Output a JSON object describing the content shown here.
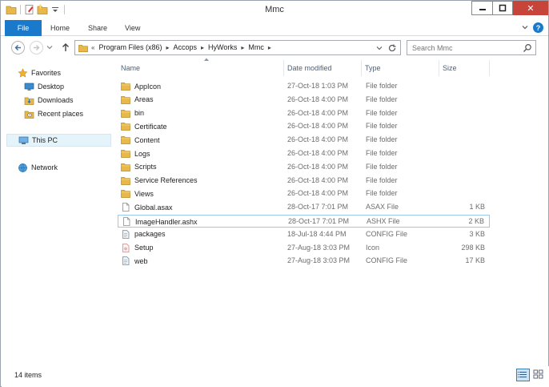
{
  "window": {
    "title": "Mmc",
    "close_glyph": "✕"
  },
  "ribbon": {
    "tabs": [
      {
        "label": "File"
      },
      {
        "label": "Home"
      },
      {
        "label": "Share"
      },
      {
        "label": "View"
      }
    ],
    "help_glyph": "?"
  },
  "address": {
    "overflow_glyph": "«",
    "crumbs": [
      "Program Files (x86)",
      "Accops",
      "HyWorks",
      "Mmc"
    ],
    "separator": "▸"
  },
  "search": {
    "placeholder": "Search Mmc"
  },
  "nav": {
    "favorites": "Favorites",
    "desktop": "Desktop",
    "downloads": "Downloads",
    "recent": "Recent places",
    "thispc": "This PC",
    "network": "Network"
  },
  "columns": {
    "name": "Name",
    "date": "Date modified",
    "type": "Type",
    "size": "Size"
  },
  "files": [
    {
      "name": "AppIcon",
      "date": "27-Oct-18 1:03 PM",
      "type": "File folder",
      "size": "",
      "icon": "folder-icon"
    },
    {
      "name": "Areas",
      "date": "26-Oct-18 4:00 PM",
      "type": "File folder",
      "size": "",
      "icon": "folder-icon"
    },
    {
      "name": "bin",
      "date": "26-Oct-18 4:00 PM",
      "type": "File folder",
      "size": "",
      "icon": "folder-icon"
    },
    {
      "name": "Certificate",
      "date": "26-Oct-18 4:00 PM",
      "type": "File folder",
      "size": "",
      "icon": "folder-icon"
    },
    {
      "name": "Content",
      "date": "26-Oct-18 4:00 PM",
      "type": "File folder",
      "size": "",
      "icon": "folder-icon"
    },
    {
      "name": "Logs",
      "date": "26-Oct-18 4:00 PM",
      "type": "File folder",
      "size": "",
      "icon": "folder-icon"
    },
    {
      "name": "Scripts",
      "date": "26-Oct-18 4:00 PM",
      "type": "File folder",
      "size": "",
      "icon": "folder-icon"
    },
    {
      "name": "Service References",
      "date": "26-Oct-18 4:00 PM",
      "type": "File folder",
      "size": "",
      "icon": "folder-icon"
    },
    {
      "name": "Views",
      "date": "26-Oct-18 4:00 PM",
      "type": "File folder",
      "size": "",
      "icon": "folder-icon"
    },
    {
      "name": "Global.asax",
      "date": "28-Oct-17 7:01 PM",
      "type": "ASAX File",
      "size": "1 KB",
      "icon": "document-icon"
    },
    {
      "name": "ImageHandler.ashx",
      "date": "28-Oct-17 7:01 PM",
      "type": "ASHX File",
      "size": "2 KB",
      "icon": "document-icon"
    },
    {
      "name": "packages",
      "date": "18-Jul-18 4:44 PM",
      "type": "CONFIG File",
      "size": "3 KB",
      "icon": "config-file-icon"
    },
    {
      "name": "Setup",
      "date": "27-Aug-18 3:03 PM",
      "type": "Icon",
      "size": "298 KB",
      "icon": "image-file-icon"
    },
    {
      "name": "web",
      "date": "27-Aug-18 3:03 PM",
      "type": "CONFIG File",
      "size": "17 KB",
      "icon": "config-file-icon"
    }
  ],
  "status": {
    "count": "14 items"
  },
  "colors": {
    "accent": "#1979ca",
    "folder": "#e8b84a",
    "close": "#c7443b",
    "selection_border": "#99c9ef"
  }
}
